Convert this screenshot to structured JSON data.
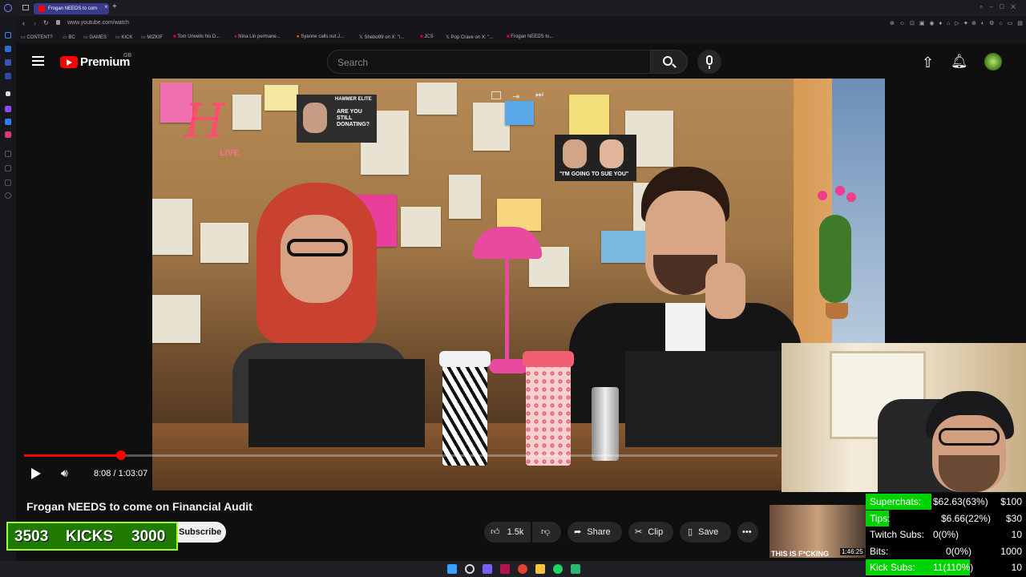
{
  "browser": {
    "tab_title": "Frogan NEEDS to com",
    "url": "www.youtube.com/watch",
    "bookmarks": [
      "CONTENT?",
      "BC",
      "GAMES",
      "KICK",
      "MIZKIF",
      "Tom Unveils his D...",
      "Nina Lin permane...",
      "Syanne calls out J...",
      "Shebo99 on X: \"i...",
      "JCS",
      "Pop Crave on X: \"...",
      "Frogan NEEDS to..."
    ]
  },
  "youtube": {
    "logo_text": "Premium",
    "region": "GB",
    "search_placeholder": "Search"
  },
  "player": {
    "time": "8:08 / 1:03:07",
    "progress_fraction": 0.129,
    "title": "Frogan NEEDS to come on Financial Audit",
    "subscribe_label": "Subscribe",
    "likes": "1.5k",
    "share_label": "Share",
    "clip_label": "Clip",
    "save_label": "Save",
    "up_next_duration": "1:46:25",
    "up_next_caption": "THIS IS F*CKING"
  },
  "video_content": {
    "logo": "H",
    "logo_sub": "LIVE",
    "poster1": "ARE YOU STILL DONATING?",
    "poster1_header": "HAMMER ELITE",
    "poster2": "\"I'M GOING TO SUE YOU\""
  },
  "overlay": {
    "kicks_current": "3503",
    "kicks_label": "KICKS",
    "kicks_goal": "3000",
    "goals": [
      {
        "label": "Superchats:",
        "value": "$62.63(63%)",
        "target": "$100",
        "fraction": 0.63
      },
      {
        "label": "Tips:",
        "value": "$6.66(22%)",
        "target": "$30",
        "fraction": 0.22
      },
      {
        "label": "Twitch Subs:",
        "value": "0(0%)",
        "target": "10",
        "fraction": 0
      },
      {
        "label": "Bits:",
        "value": "0(0%)",
        "target": "1000",
        "fraction": 0
      },
      {
        "label": "Kick Subs:",
        "value": "11(110%)",
        "target": "10",
        "fraction": 1
      }
    ]
  },
  "colors": {
    "yt_red": "#ff0000",
    "goal_green": "#00d400",
    "kicks_green": "#1e7a00"
  }
}
